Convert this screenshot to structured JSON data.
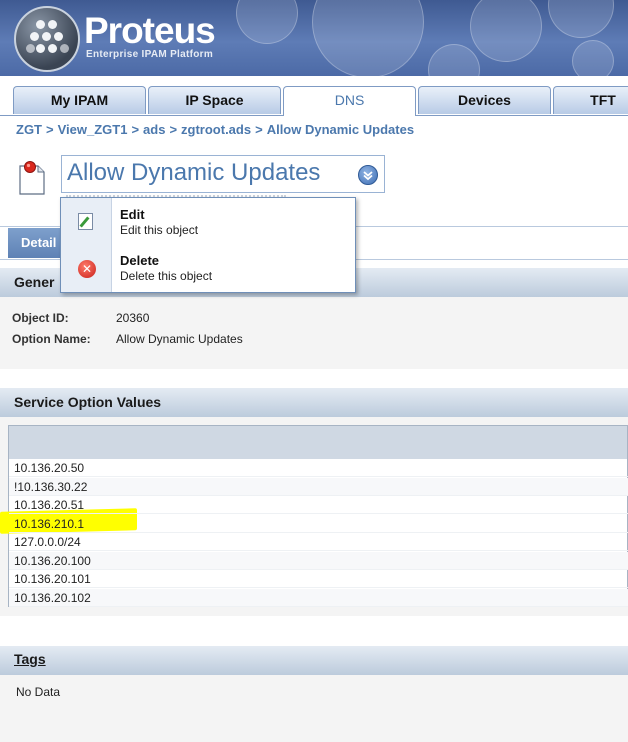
{
  "header": {
    "logo_title": "Proteus",
    "logo_subtitle": "Enterprise IPAM Platform"
  },
  "tabs": [
    {
      "label": "My IPAM",
      "active": false
    },
    {
      "label": "IP Space",
      "active": false
    },
    {
      "label": "DNS",
      "active": true
    },
    {
      "label": "Devices",
      "active": false
    },
    {
      "label": "TFT",
      "active": false
    }
  ],
  "breadcrumb": [
    "ZGT",
    "View_ZGT1",
    "ads",
    "zgtroot.ads",
    "Allow Dynamic Updates"
  ],
  "breadcrumb_separator": ">",
  "page_title": "Allow Dynamic Updates",
  "details_tab": "Detail",
  "general_section": {
    "title": "Gener",
    "fields": [
      {
        "label": "Object ID:",
        "value": "20360"
      },
      {
        "label": "Option Name:",
        "value": "Allow Dynamic Updates"
      }
    ]
  },
  "service_option_values": {
    "title": "Service Option Values",
    "values": [
      "10.136.20.50",
      "!10.136.30.22",
      "10.136.20.51",
      "10.136.210.1",
      "127.0.0.0/24",
      "10.136.20.100",
      "10.136.20.101",
      "10.136.20.102"
    ],
    "highlighted_value": "10.136.210.1",
    "highlight_color": "#ffff00"
  },
  "tags": {
    "title": "Tags",
    "body": "No Data"
  },
  "context_menu": {
    "items": [
      {
        "title": "Edit",
        "description": "Edit this object",
        "icon": "edit-icon"
      },
      {
        "title": "Delete",
        "description": "Delete this object",
        "icon": "delete-icon"
      }
    ]
  },
  "colors": {
    "link_blue": "#4b78ad",
    "header_blue": "#4c6aa6"
  }
}
